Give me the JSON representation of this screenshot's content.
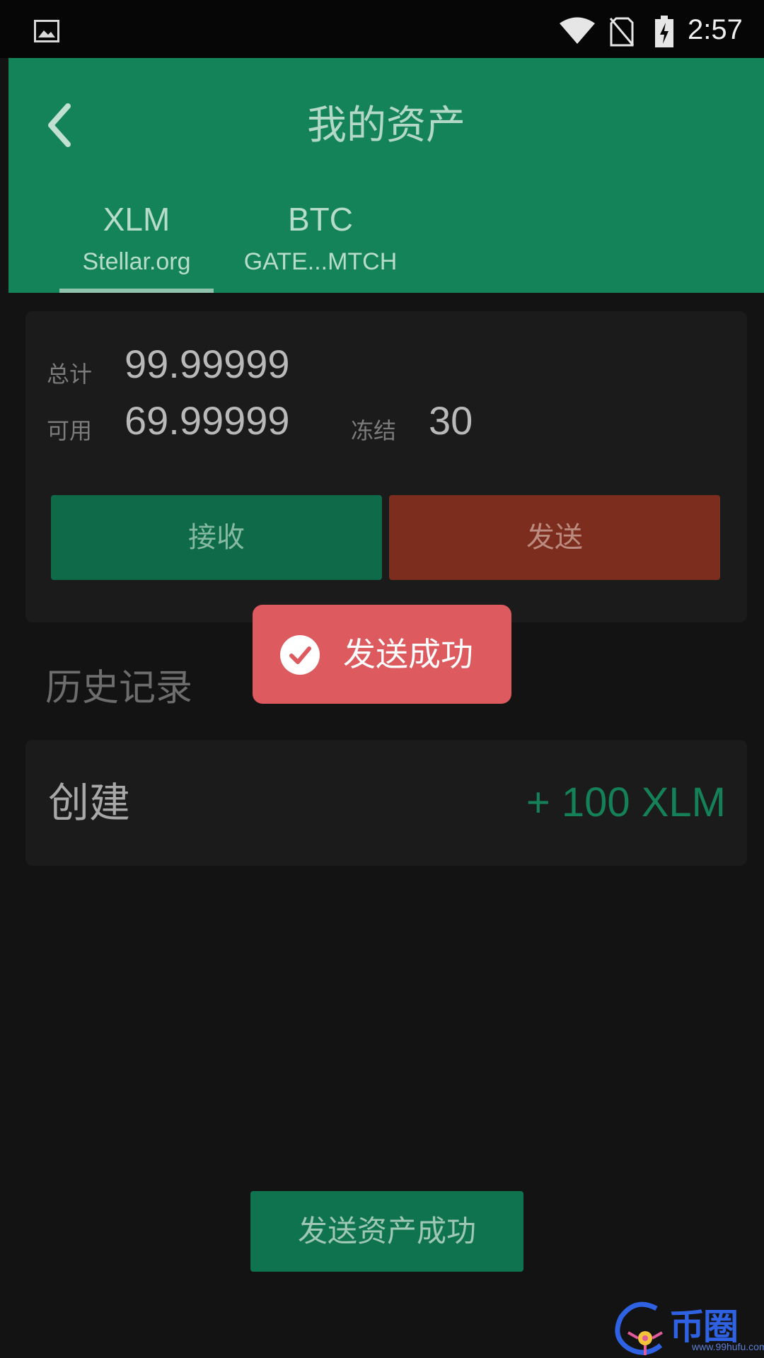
{
  "status_bar": {
    "time": "2:57",
    "icons": [
      "gallery-icon",
      "wifi-icon",
      "no-sim-icon",
      "battery-charging-icon"
    ]
  },
  "header": {
    "title": "我的资产",
    "back_icon": "chevron-left-icon",
    "tabs": [
      {
        "code": "XLM",
        "issuer": "Stellar.org",
        "selected": true
      },
      {
        "code": "BTC",
        "issuer": "GATE...MTCH",
        "selected": false
      }
    ]
  },
  "balance": {
    "total_label": "总计",
    "total_value": "99.99999",
    "available_label": "可用",
    "available_value": "69.99999",
    "frozen_label": "冻结",
    "frozen_value": "30",
    "receive_label": "接收",
    "send_label": "发送"
  },
  "toast": {
    "icon": "check-circle-icon",
    "text": "发送成功"
  },
  "history": {
    "title": "历史记录",
    "items": [
      {
        "type": "创建",
        "amount": "+ 100 XLM"
      }
    ]
  },
  "bottom_button": {
    "label": "发送资产成功"
  },
  "watermark": {
    "text": "币圈子",
    "domain": "www.99hufu.com"
  },
  "colors": {
    "primary": "#14835a",
    "send": "#7c2d1e",
    "toast": "#dd5a5f",
    "background": "#131313",
    "card": "#1b1b1b"
  }
}
